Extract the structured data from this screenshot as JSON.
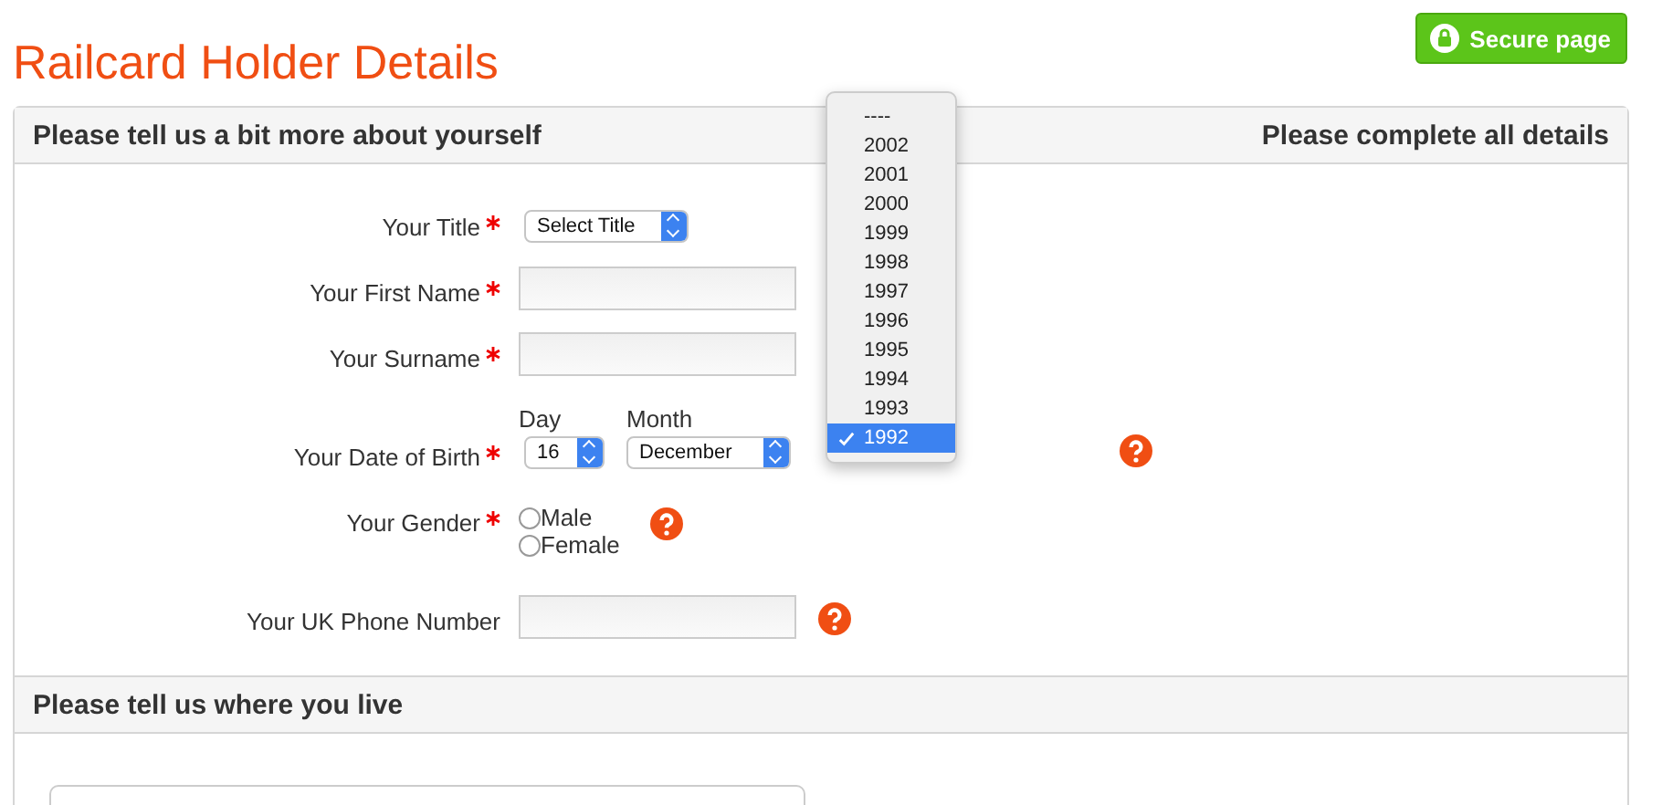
{
  "page": {
    "title": "Railcard Holder Details",
    "secure_badge": "Secure page"
  },
  "section_1": {
    "heading": "Please tell us a bit more about yourself",
    "note": "Please complete all details",
    "fields": [
      {
        "kind": "select",
        "label": "Your Title",
        "required": true,
        "value": "Select Title"
      },
      {
        "kind": "text",
        "label": "Your First Name",
        "required": true
      },
      {
        "kind": "text",
        "label": "Your Surname",
        "required": true
      },
      {
        "kind": "date",
        "label": "Your Date of Birth",
        "required": true,
        "day_label": "Day",
        "day": "16",
        "month_label": "Month",
        "month": "December",
        "help": true
      },
      {
        "kind": "radio",
        "label": "Your Gender",
        "required": true,
        "help": true,
        "options": [
          {
            "label": "Male",
            "selected": false
          },
          {
            "label": "Female",
            "selected": false
          }
        ]
      },
      {
        "kind": "text",
        "label": "Your UK Phone Number",
        "required": false,
        "help": true
      }
    ]
  },
  "year_dropdown": {
    "options": [
      {
        "label": "----",
        "selected": false
      },
      {
        "label": "2002",
        "selected": false
      },
      {
        "label": "2001",
        "selected": false
      },
      {
        "label": "2000",
        "selected": false
      },
      {
        "label": "1999",
        "selected": false
      },
      {
        "label": "1998",
        "selected": false
      },
      {
        "label": "1997",
        "selected": false
      },
      {
        "label": "1996",
        "selected": false
      },
      {
        "label": "1995",
        "selected": false
      },
      {
        "label": "1994",
        "selected": false
      },
      {
        "label": "1993",
        "selected": false
      },
      {
        "label": "1992",
        "selected": true
      }
    ]
  },
  "section_2": {
    "heading": "Please tell us where you live"
  }
}
